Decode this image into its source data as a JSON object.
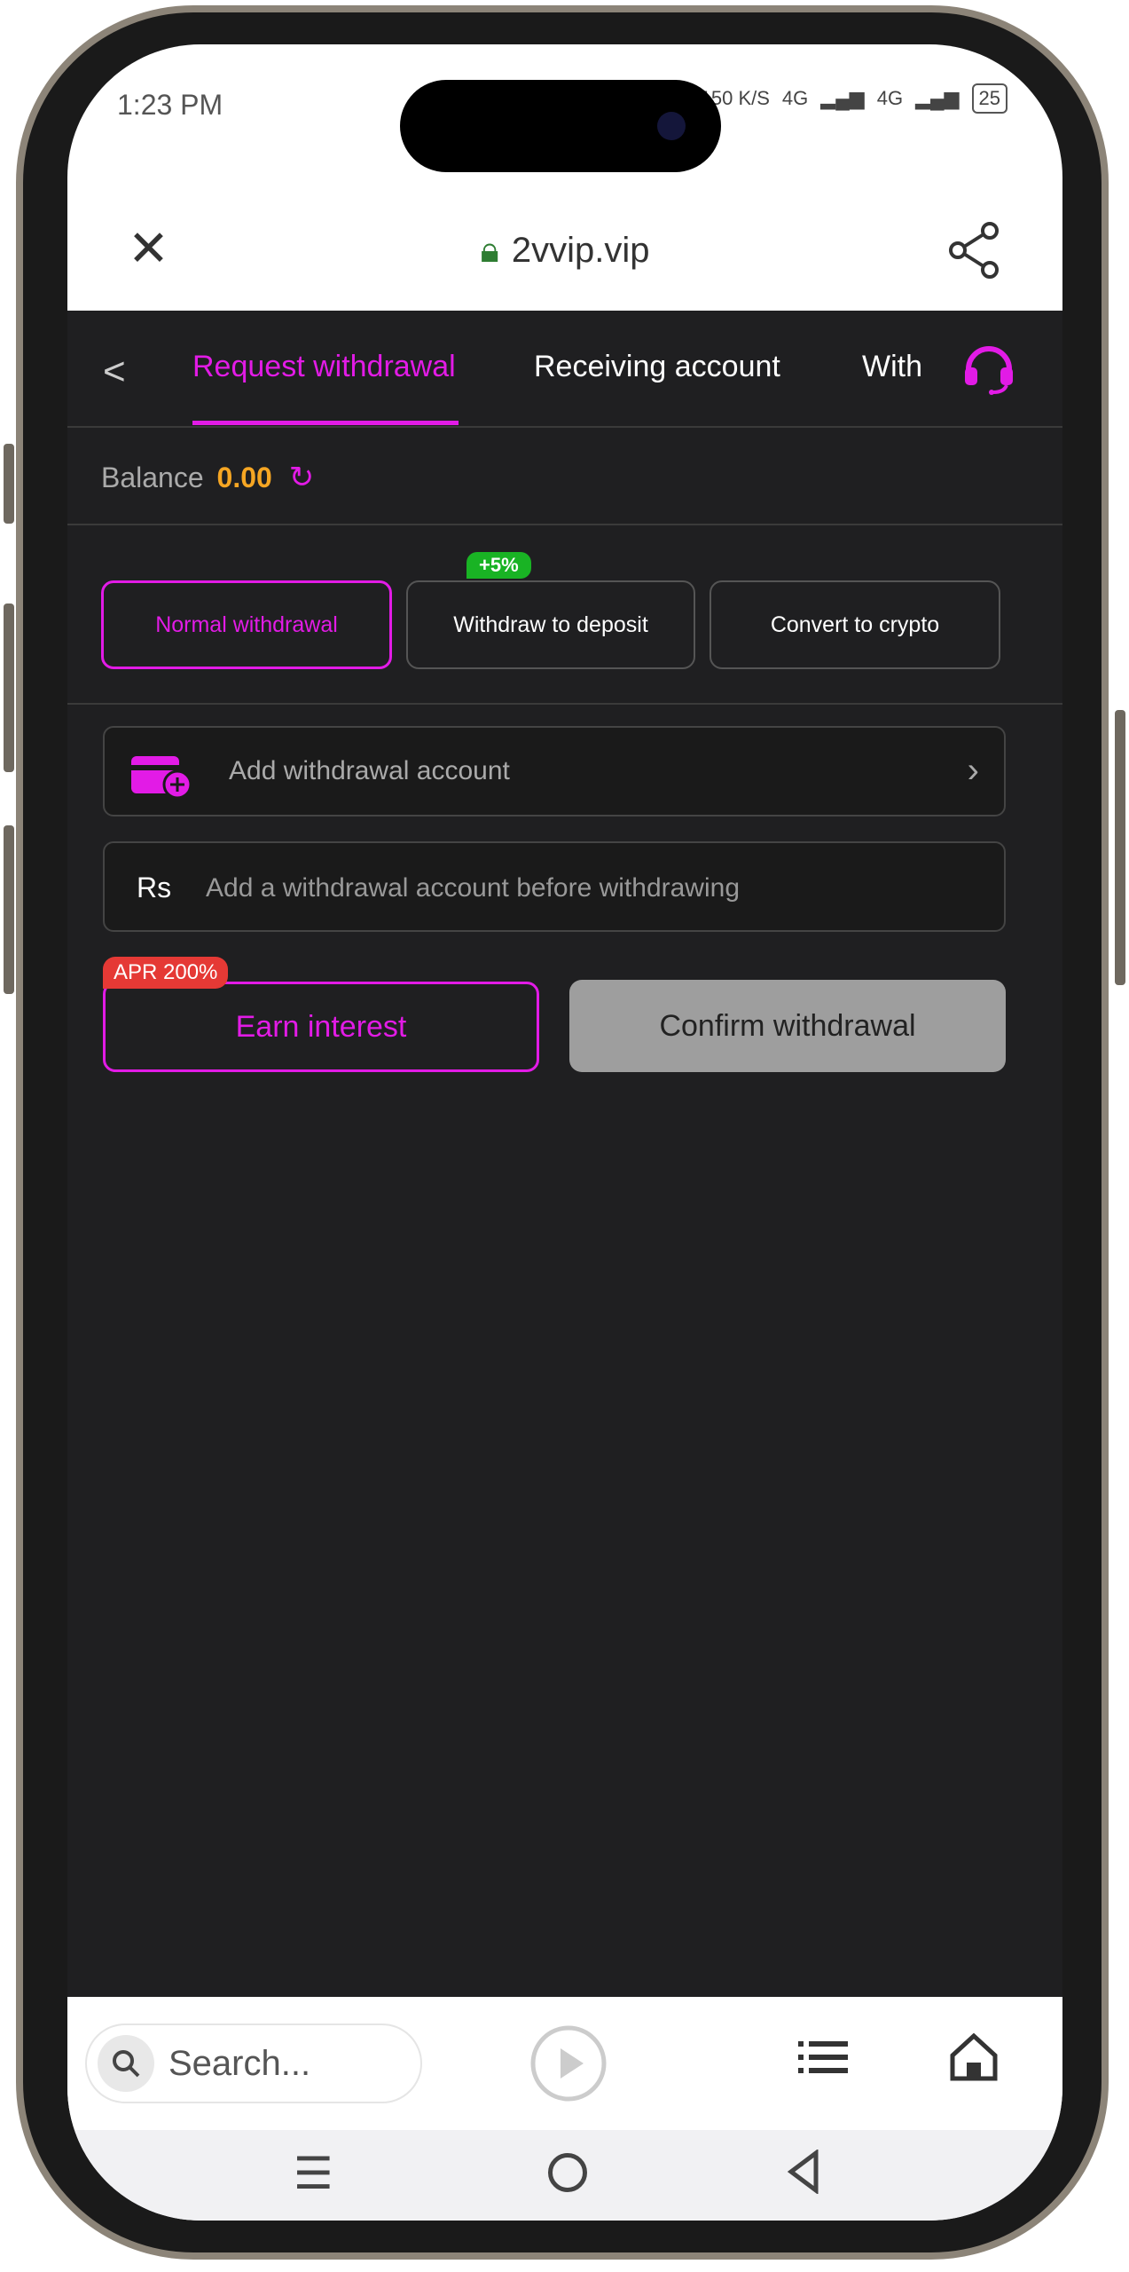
{
  "status_bar": {
    "time": "1:23 PM",
    "speed": "150 K/S",
    "network": "4G",
    "network2": "4G",
    "battery": "25"
  },
  "browser": {
    "url": "2vvip.vip",
    "close_icon": "close-icon",
    "share_icon": "share-icon"
  },
  "tabs": [
    {
      "label": "Request withdrawal",
      "active": true
    },
    {
      "label": "Receiving account",
      "active": false
    },
    {
      "label": "With",
      "active": false
    }
  ],
  "balance": {
    "label": "Balance",
    "value": "0.00"
  },
  "withdraw_types": [
    {
      "label": "Normal withdrawal",
      "active": true
    },
    {
      "label": "Withdraw to deposit",
      "badge": "+5%"
    },
    {
      "label": "Convert to crypto"
    }
  ],
  "account": {
    "placeholder": "Add withdrawal account"
  },
  "amount": {
    "currency": "Rs",
    "placeholder": "Add a withdrawal account before withdrawing"
  },
  "actions": {
    "earn_label": "Earn interest",
    "earn_badge": "APR 200%",
    "confirm_label": "Confirm withdrawal"
  },
  "bottom_nav": {
    "search_placeholder": "Search..."
  },
  "colors": {
    "accent": "#e21be6",
    "balance": "#f6a623",
    "badge_green": "#19b324",
    "badge_red": "#e53935",
    "app_bg": "#1f1f21"
  }
}
